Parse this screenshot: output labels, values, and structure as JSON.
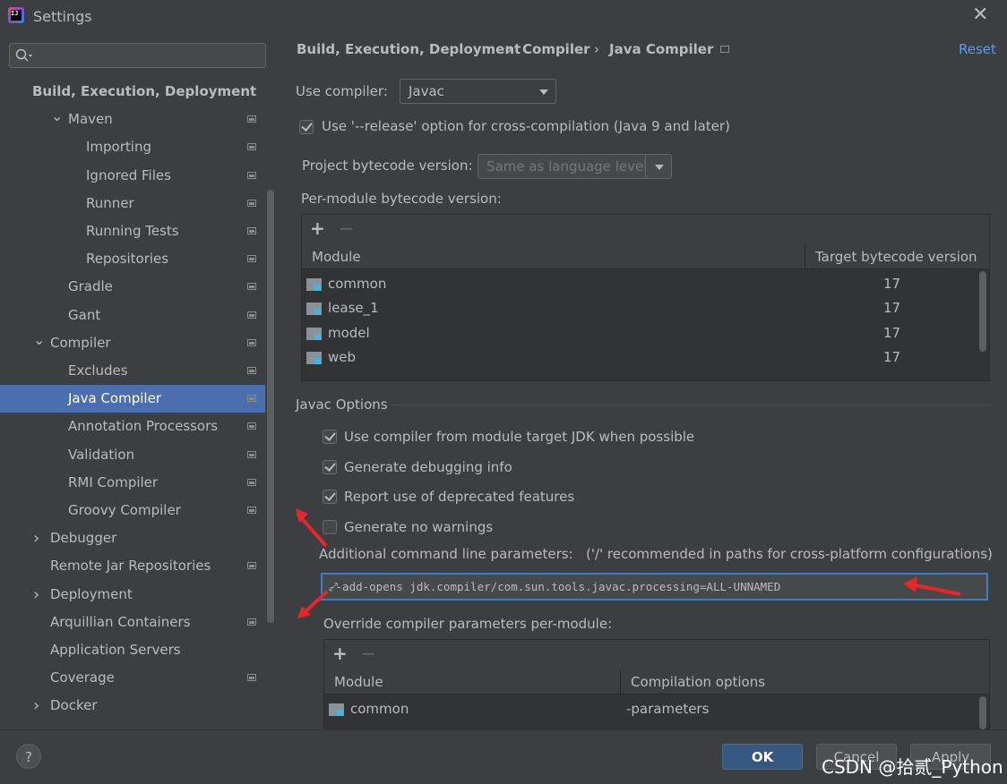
{
  "window": {
    "title": "Settings",
    "app_icon": "intellij-icon",
    "close": "close-icon"
  },
  "sidebar": {
    "search_placeholder": "",
    "items": [
      {
        "label": "Build, Execution, Deployment",
        "level": 0,
        "bold": true
      },
      {
        "label": "Maven",
        "level": 1,
        "expanded": true
      },
      {
        "label": "Importing",
        "level": 2
      },
      {
        "label": "Ignored Files",
        "level": 2
      },
      {
        "label": "Runner",
        "level": 2
      },
      {
        "label": "Running Tests",
        "level": 2
      },
      {
        "label": "Repositories",
        "level": 2
      },
      {
        "label": "Gradle",
        "level": 1
      },
      {
        "label": "Gant",
        "level": 1
      },
      {
        "label": "Compiler",
        "level": 0,
        "expanded": true
      },
      {
        "label": "Excludes",
        "level": 1
      },
      {
        "label": "Java Compiler",
        "level": 1,
        "selected": true
      },
      {
        "label": "Annotation Processors",
        "level": 1
      },
      {
        "label": "Validation",
        "level": 1
      },
      {
        "label": "RMI Compiler",
        "level": 1
      },
      {
        "label": "Groovy Compiler",
        "level": 1
      },
      {
        "label": "Debugger",
        "level": 0,
        "collapsed": true
      },
      {
        "label": "Remote Jar Repositories",
        "level": 0
      },
      {
        "label": "Deployment",
        "level": 0,
        "collapsed": true
      },
      {
        "label": "Arquillian Containers",
        "level": 0
      },
      {
        "label": "Application Servers",
        "level": 0
      },
      {
        "label": "Coverage",
        "level": 0
      },
      {
        "label": "Docker",
        "level": 0,
        "collapsed": true
      }
    ]
  },
  "breadcrumb": [
    "Build, Execution, Deployment",
    "Compiler",
    "Java Compiler"
  ],
  "breadcrumb_sep": "›",
  "reset_label": "Reset",
  "use_compiler": {
    "label": "Use compiler:",
    "value": "Javac"
  },
  "release_option": {
    "label": "Use '--release' option for cross-compilation (Java 9 and later)",
    "checked": true
  },
  "project_bytecode": {
    "label": "Project bytecode version:",
    "value": "Same as language level"
  },
  "per_module": {
    "label": "Per-module bytecode version:",
    "headers": [
      "Module",
      "Target bytecode version"
    ],
    "rows": [
      {
        "module": "common",
        "version": "17"
      },
      {
        "module": "lease_1",
        "version": "17"
      },
      {
        "module": "model",
        "version": "17"
      },
      {
        "module": "web",
        "version": "17"
      }
    ]
  },
  "javac_options": {
    "section_title": "Javac Options",
    "options": [
      {
        "label": "Use compiler from module target JDK when possible",
        "checked": true
      },
      {
        "label": "Generate debugging info",
        "checked": true
      },
      {
        "label": "Report use of deprecated features",
        "checked": true
      },
      {
        "label": "Generate no warnings",
        "checked": false
      }
    ],
    "additional_label": "Additional command line parameters:",
    "additional_hint": "('/' recommended in paths for cross-platform configurations)",
    "additional_value": "--add-opens jdk.compiler/com.sun.tools.javac.processing=ALL-UNNAMED",
    "override_label": "Override compiler parameters per-module:",
    "override_headers": [
      "Module",
      "Compilation options"
    ],
    "override_rows": [
      {
        "module": "common",
        "options": "-parameters"
      }
    ]
  },
  "buttons": {
    "help": "?",
    "ok": "OK",
    "cancel": "Cancel",
    "apply": "Apply"
  },
  "watermark": "CSDN @拾贰_Python",
  "colors": {
    "selection": "#4b6eaf",
    "accent_link": "#589df6",
    "focus": "#3d7ecc",
    "annotation_arrow": "#e8262a"
  }
}
